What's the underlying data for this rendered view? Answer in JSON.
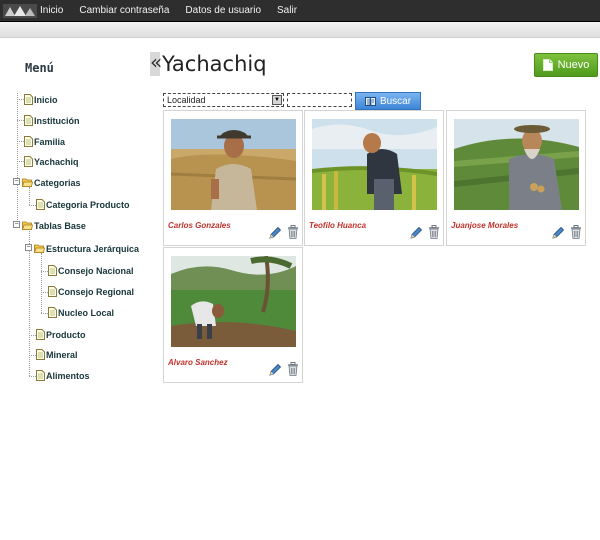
{
  "topnav": {
    "items": [
      {
        "label": "Inicio"
      },
      {
        "label": "Cambiar contraseña"
      },
      {
        "label": "Datos de usuario"
      },
      {
        "label": "Salir"
      }
    ]
  },
  "sidebar": {
    "title": "Menú",
    "tree": [
      {
        "label": "Inicio",
        "type": "doc"
      },
      {
        "label": "Institución",
        "type": "doc"
      },
      {
        "label": "Familia",
        "type": "doc"
      },
      {
        "label": "Yachachiq",
        "type": "doc"
      },
      {
        "label": "Categorias",
        "type": "folder"
      },
      {
        "label": "Categoria Producto",
        "type": "doc"
      },
      {
        "label": "Tablas Base",
        "type": "folder"
      },
      {
        "label": "Estructura Jerárquica",
        "type": "folder"
      },
      {
        "label": "Consejo Nacional",
        "type": "doc"
      },
      {
        "label": "Consejo Regional",
        "type": "doc"
      },
      {
        "label": "Nucleo Local",
        "type": "doc"
      },
      {
        "label": "Producto",
        "type": "doc"
      },
      {
        "label": "Mineral",
        "type": "doc"
      },
      {
        "label": "Alimentos",
        "type": "doc"
      }
    ]
  },
  "main": {
    "collapse_glyph": "«",
    "title": "Yachachiq",
    "new_button": "Nuevo",
    "filter": {
      "selected": "Localidad"
    },
    "search_input": {
      "value": ""
    },
    "search_button": "Buscar"
  },
  "cards": [
    {
      "name": "Carlos Gonzales"
    },
    {
      "name": "Teofilo Huanca"
    },
    {
      "name": "Juanjose Morales"
    },
    {
      "name": "Alvaro Sanchez"
    }
  ],
  "colors": {
    "topbar": "#2e2e2e",
    "accent_green": "#5aa524",
    "accent_blue": "#4a90e2",
    "person_name": "#c0322b"
  }
}
